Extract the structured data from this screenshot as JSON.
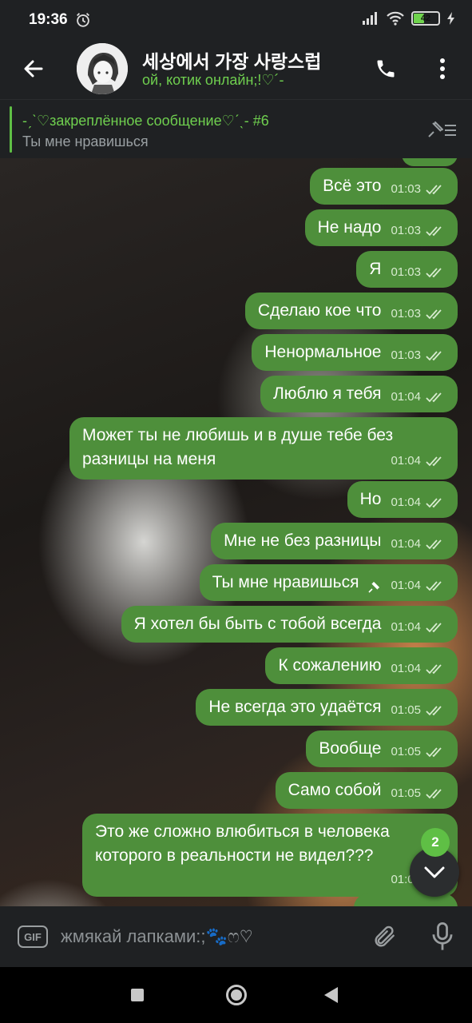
{
  "status_bar": {
    "time": "19:36",
    "battery": "42"
  },
  "header": {
    "title": "세상에서 가장 사랑스럽",
    "status": "ой, котик онлайн;!♡´-"
  },
  "pinned": {
    "title": "-ˏˋ♡закреплённое сообщение♡ˊˎ- #6",
    "text": "Ты мне нравишься"
  },
  "messages": [
    {
      "text": "Всё это",
      "time": "01:03"
    },
    {
      "text": "Не надо",
      "time": "01:03"
    },
    {
      "text": "Я",
      "time": "01:03"
    },
    {
      "text": "Сделаю кое что",
      "time": "01:03"
    },
    {
      "text": "Ненормальное",
      "time": "01:03"
    },
    {
      "text": "Люблю я тебя",
      "time": "01:04"
    },
    {
      "text": "Может ты не любишь и в душе тебе без разницы на меня",
      "time": "01:04"
    },
    {
      "text": "Но",
      "time": "01:04"
    },
    {
      "text": "Мне не без разницы",
      "time": "01:04"
    },
    {
      "text": "Ты мне нравишься",
      "time": "01:04",
      "pinned": true
    },
    {
      "text": "Я хотел бы быть с тобой всегда",
      "time": "01:04"
    },
    {
      "text": "К сожалению",
      "time": "01:04"
    },
    {
      "text": "Не всегда это удаётся",
      "time": "01:05"
    },
    {
      "text": "Вообще",
      "time": "01:05"
    },
    {
      "text": "Само собой",
      "time": "01:05"
    },
    {
      "text": "Это же сложно влюбиться в человека которого в реальности не видел???",
      "time": "01:05"
    }
  ],
  "scroll_down": {
    "unread_count": "2"
  },
  "composer": {
    "gif_label": "GIF",
    "placeholder": "жмякай лапками:;🐾ෆ♡"
  },
  "icons": {
    "back": "arrow-left-icon",
    "call": "phone-icon",
    "menu": "more-vertical-icon",
    "pinned_list": "pinned-list-icon",
    "attach": "paperclip-icon",
    "mic": "microphone-icon",
    "read": "double-check-icon",
    "alarm": "alarm-icon"
  },
  "colors": {
    "accent": "#5fbf45",
    "bubble": "#4e8f3b",
    "panel": "#1f2123"
  }
}
